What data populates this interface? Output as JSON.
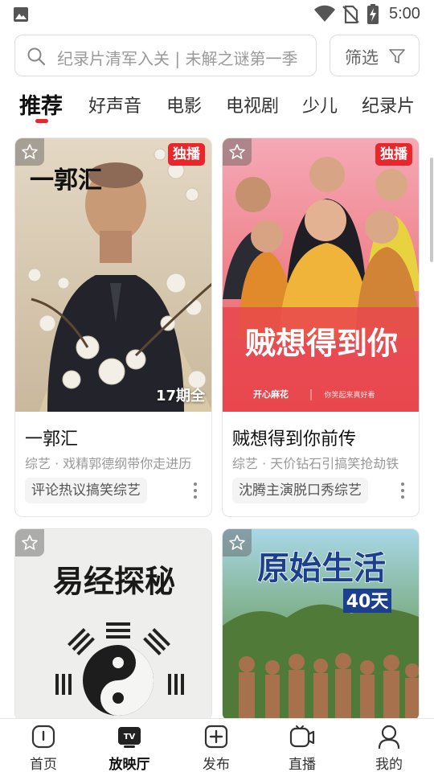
{
  "status_bar": {
    "time": "5:00",
    "icons": [
      "gallery-icon",
      "wifi-icon",
      "no-sim-icon",
      "battery-charging-icon"
    ]
  },
  "search": {
    "placeholder": "纪录片清军入关 | 未解之谜第一季",
    "icon": "search-icon"
  },
  "filter": {
    "label": "筛选",
    "icon": "filter-icon"
  },
  "tabs": [
    {
      "label": "推荐",
      "active": true
    },
    {
      "label": "好声音"
    },
    {
      "label": "电影"
    },
    {
      "label": "电视剧"
    },
    {
      "label": "少儿"
    },
    {
      "label": "纪录片"
    }
  ],
  "cards": [
    {
      "poster_text": "一郭汇",
      "badge": "独播",
      "episodes": "17期全",
      "title": "一郭汇",
      "subtitle": "综艺 · 戏精郭德纲带你走进历",
      "tag": "评论热议搞笑综艺"
    },
    {
      "poster_text": "贼想得到你",
      "poster_sub_left": "开心麻花",
      "poster_sub_right": "你笑起来真好看",
      "badge": "独播",
      "title": "贼想得到你前传",
      "subtitle": "综艺 · 天价钻石引搞笑抢劫铁",
      "tag": "沈腾主演脱口秀综艺"
    },
    {
      "poster_text": "易经探秘"
    },
    {
      "poster_text": "原始生活",
      "poster_sub": "40天"
    }
  ],
  "bottom_nav": [
    {
      "label": "首页",
      "icon": "home-icon"
    },
    {
      "label": "放映厅",
      "icon": "tv-icon",
      "icon_text": "TV",
      "active": true
    },
    {
      "label": "发布",
      "icon": "add-icon"
    },
    {
      "label": "直播",
      "icon": "live-camera-icon"
    },
    {
      "label": "我的",
      "icon": "profile-icon"
    }
  ],
  "colors": {
    "accent": "#e8262c",
    "card_border": "#e6e6e6"
  }
}
